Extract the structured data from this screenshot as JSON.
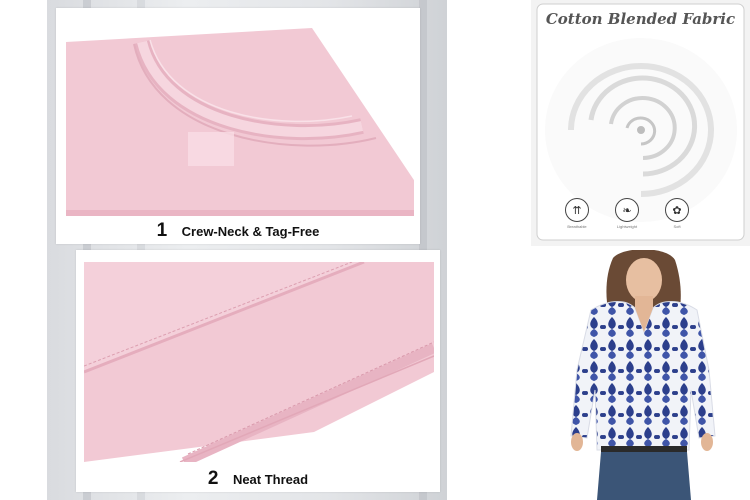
{
  "detail1": {
    "number": "1",
    "label": "Crew-Neck & Tag-Free"
  },
  "detail2": {
    "number": "2",
    "label": "Neat Thread"
  },
  "fabric": {
    "title": "Cotton Blended Fabric",
    "features": [
      {
        "icon": "breathable-icon",
        "label": "Breathable"
      },
      {
        "icon": "lightweight-icon",
        "label": "Lightweight"
      },
      {
        "icon": "soft-icon",
        "label": "Soft"
      }
    ]
  },
  "colors": {
    "shirt_pink": "#f2c9d4",
    "print_blue": "#2c3f8c"
  }
}
